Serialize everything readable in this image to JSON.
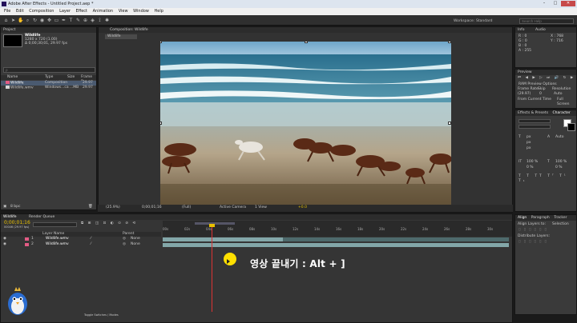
{
  "window": {
    "title": "Adobe After Effects - Untitled Project.aep *",
    "minimize": "–",
    "maximize": "□",
    "close": "✕"
  },
  "menu": [
    "File",
    "Edit",
    "Composition",
    "Layer",
    "Effect",
    "Animation",
    "View",
    "Window",
    "Help"
  ],
  "toolbar": {
    "workspace_label": "Workspace:",
    "workspace_value": "Standard",
    "search_placeholder": "Search Help"
  },
  "project": {
    "tab": "Project",
    "item_name": "Wildlife",
    "item_info1": "1280 x 720 (1.00)",
    "item_info2": "Δ 0;00;30;01, 29.97 fps",
    "search_placeholder": "ρ",
    "columns": [
      "Name",
      "Type",
      "Size",
      "Frame R..."
    ],
    "items": [
      {
        "name": "Wildlife",
        "type": "Composition",
        "size": "",
        "fps": "29.97"
      },
      {
        "name": "Wildlife.wmv",
        "type": "Windows...ca",
        "size": "...MB",
        "fps": "29.97"
      }
    ],
    "bpc": "8 bpc"
  },
  "composition": {
    "tab": "Composition: Wildlife",
    "subtab": "Wildlife",
    "zoom": "(25.9%)",
    "time": "0;00;01;16",
    "resolution": "(Full)",
    "camera": "Active Camera",
    "views": "1 View",
    "exposure": "+0.0"
  },
  "info": {
    "tabs": [
      "Info",
      "Audio"
    ],
    "lines": [
      "R : 0",
      "G : 0",
      "B : 0",
      "A : 255"
    ],
    "coords": [
      "X : 768",
      "Y : 716"
    ]
  },
  "preview": {
    "tab": "Preview",
    "ram_options": "RAM Preview Options",
    "frame_rate_label": "Frame Rate",
    "skip_label": "Skip",
    "resolution_label": "Resolution",
    "frame_rate": "(29.97)",
    "skip": "0",
    "resolution": "Auto",
    "from_current": "From Current Time",
    "full_screen": "Full Screen"
  },
  "effects": {
    "tabs": [
      "Effects & Presets",
      "Character"
    ],
    "font_px": "px",
    "auto": "Auto",
    "values": [
      "px",
      "px",
      "px",
      "100 %",
      "100 %",
      "0 %",
      "0 %",
      "0 %"
    ]
  },
  "align": {
    "tabs": [
      "Align",
      "Paragraph",
      "Tracker"
    ],
    "align_to_label": "Align Layers to:",
    "align_to_value": "Selection",
    "distribute_label": "Distribute Layers:"
  },
  "timeline": {
    "tabs": [
      "Wildlife",
      "Render Queue"
    ],
    "time": "0;00;01;16",
    "fps_info": "00046 (29.97 fps)",
    "columns": [
      "Layer Name",
      "Parent"
    ],
    "layers": [
      {
        "num": "1",
        "name": "Wildlife.wmv",
        "parent": "None"
      },
      {
        "num": "2",
        "name": "Wildlife.wmv",
        "parent": "None"
      }
    ],
    "ruler": [
      "00s",
      "02s",
      "04s",
      "06s",
      "08s",
      "10s",
      "12s",
      "14s",
      "16s",
      "18s",
      "20s",
      "22s",
      "24s",
      "26s",
      "28s",
      "30s"
    ],
    "toggle": "Toggle Switches / Modes"
  },
  "caption": "영상 끝내기 : Alt + ]",
  "colors": {
    "accent": "#ffe000",
    "comp_tag": "#e35b84",
    "bar": "#83a7a9"
  }
}
